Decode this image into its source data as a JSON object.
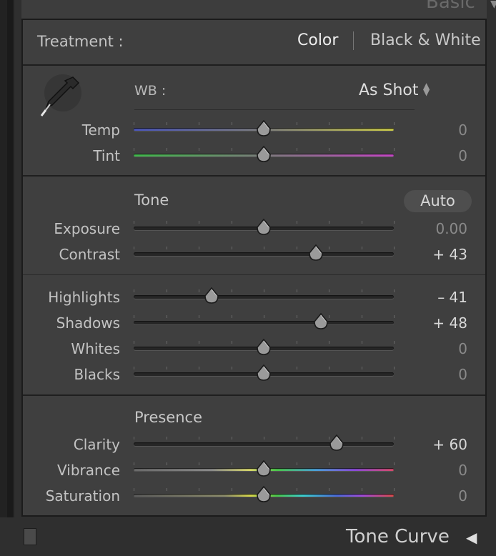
{
  "header": {
    "title": "Basic"
  },
  "treatment": {
    "label": "Treatment :",
    "options": [
      "Color",
      "Black & White"
    ],
    "selected": "Color"
  },
  "wb": {
    "label": "WB :",
    "value": "As Shot"
  },
  "colors": {
    "temp_start": "#4a55b8",
    "temp_end": "#c8c848",
    "tint_start": "#3fb84a",
    "tint_end": "#c445c4",
    "vib_start": "#8a8a8a",
    "sat_mid": "#3ccfcf"
  },
  "wb_sliders": [
    {
      "label": "Temp",
      "value": "0",
      "position": 0.5
    },
    {
      "label": "Tint",
      "value": "0",
      "position": 0.5
    }
  ],
  "tone": {
    "title": "Tone",
    "auto_label": "Auto",
    "sliders": [
      {
        "label": "Exposure",
        "value": "0.00",
        "position": 0.5
      },
      {
        "label": "Contrast",
        "value": "+ 43",
        "position": 0.7
      }
    ],
    "sliders2": [
      {
        "label": "Highlights",
        "value": "– 41",
        "position": 0.3
      },
      {
        "label": "Shadows",
        "value": "+ 48",
        "position": 0.72
      },
      {
        "label": "Whites",
        "value": "0",
        "position": 0.5
      },
      {
        "label": "Blacks",
        "value": "0",
        "position": 0.5
      }
    ]
  },
  "presence": {
    "title": "Presence",
    "sliders": [
      {
        "label": "Clarity",
        "value": "+ 60",
        "position": 0.78
      },
      {
        "label": "Vibrance",
        "value": "0",
        "position": 0.5
      },
      {
        "label": "Saturation",
        "value": "0",
        "position": 0.5
      }
    ]
  },
  "footer": {
    "next_panel": "Tone Curve"
  }
}
